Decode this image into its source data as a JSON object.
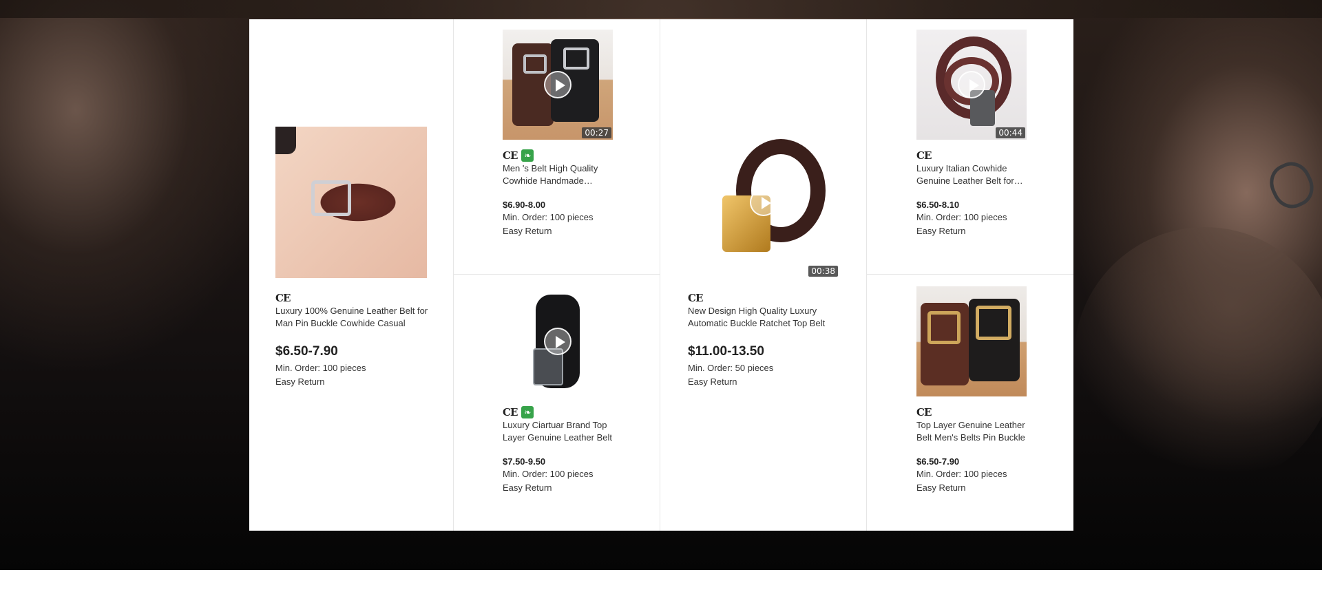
{
  "products": [
    {
      "name": "Luxury 100% Genuine Leather Belt for Man Pin Buckle Cowhide Casual",
      "price": "$6.50-7.90",
      "min_order": "Min. Order: 100 pieces",
      "return": "Easy Return",
      "cert": "CE",
      "image_icon": "brown-pin-buckle-belt-photo"
    },
    {
      "name": "Men 's Belt High Quality Cowhide Handmade Leather Belt",
      "price": "$6.90-8.00",
      "min_order": "Min. Order: 100 pieces",
      "return": "Easy Return",
      "cert": "CE",
      "duration": "00:27",
      "image_icon": "two-belts-photo"
    },
    {
      "name": "Luxury Ciartuar Brand Top Layer Genuine Leather Belt",
      "price": "$7.50-9.50",
      "min_order": "Min. Order: 100 pieces",
      "return": "Easy Return",
      "cert": "CE",
      "image_icon": "black-belt-photo"
    },
    {
      "name": "New Design High Quality Luxury Automatic Buckle Ratchet Top Belt",
      "price": "$11.00-13.50",
      "min_order": "Min. Order: 50 pieces",
      "return": "Easy Return",
      "cert": "CE",
      "duration": "00:38",
      "image_icon": "gold-buckle-belt-photo"
    },
    {
      "name": "Luxury Italian Cowhide Genuine Leather Belt for Men",
      "price": "$6.50-8.10",
      "min_order": "Min. Order: 100 pieces",
      "return": "Easy Return",
      "cert": "CE",
      "duration": "00:44",
      "image_icon": "coiled-brown-belt-photo"
    },
    {
      "name": "Top Layer Genuine Leather Belt Men's Belts Pin Buckle",
      "price": "$6.50-7.90",
      "min_order": "Min. Order: 100 pieces",
      "return": "Easy Return",
      "cert": "CE",
      "image_icon": "gold-pin-buckle-belts-photo"
    }
  ],
  "colors": {
    "leaf_badge": "#37a34a",
    "price": "#222222",
    "border": "#e6e6e6"
  }
}
